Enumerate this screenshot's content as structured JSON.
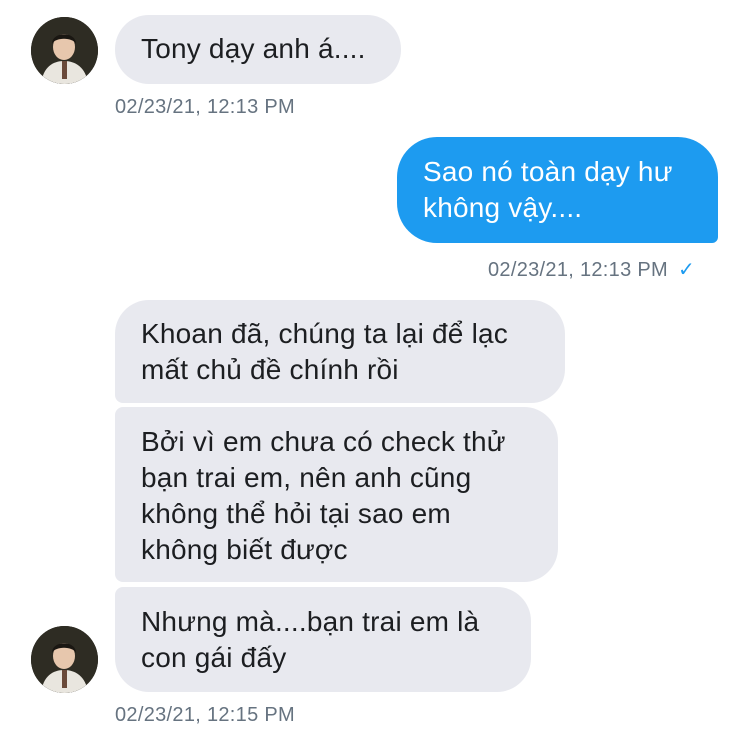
{
  "messages": [
    {
      "sender": "other",
      "text": "Tony dạy anh á...."
    },
    {
      "sender": "me",
      "text": "Sao nó toàn dạy hư\nkhông vậy...."
    },
    {
      "sender": "other",
      "text": "Khoan đã, chúng ta lại để lạc\nmất chủ đề chính rồi"
    },
    {
      "sender": "other",
      "text": "Bởi vì em chưa có check thử\nbạn trai em, nên anh cũng\nkhông thể hỏi tại sao em\nkhông biết được"
    },
    {
      "sender": "other",
      "text": "Nhưng mà....bạn trai em là\ncon gái đấy"
    }
  ],
  "timestamps": {
    "t1": "02/23/21, 12:13 PM",
    "t2": "02/23/21, 12:13 PM",
    "t3": "02/23/21, 12:15 PM"
  },
  "icons": {
    "avatar": "profile-photo",
    "read_receipt": "checkmark-icon"
  },
  "colors": {
    "sent_bubble": "#1d9bf0",
    "received_bubble": "#e8e9ef",
    "timestamp": "#667380"
  }
}
